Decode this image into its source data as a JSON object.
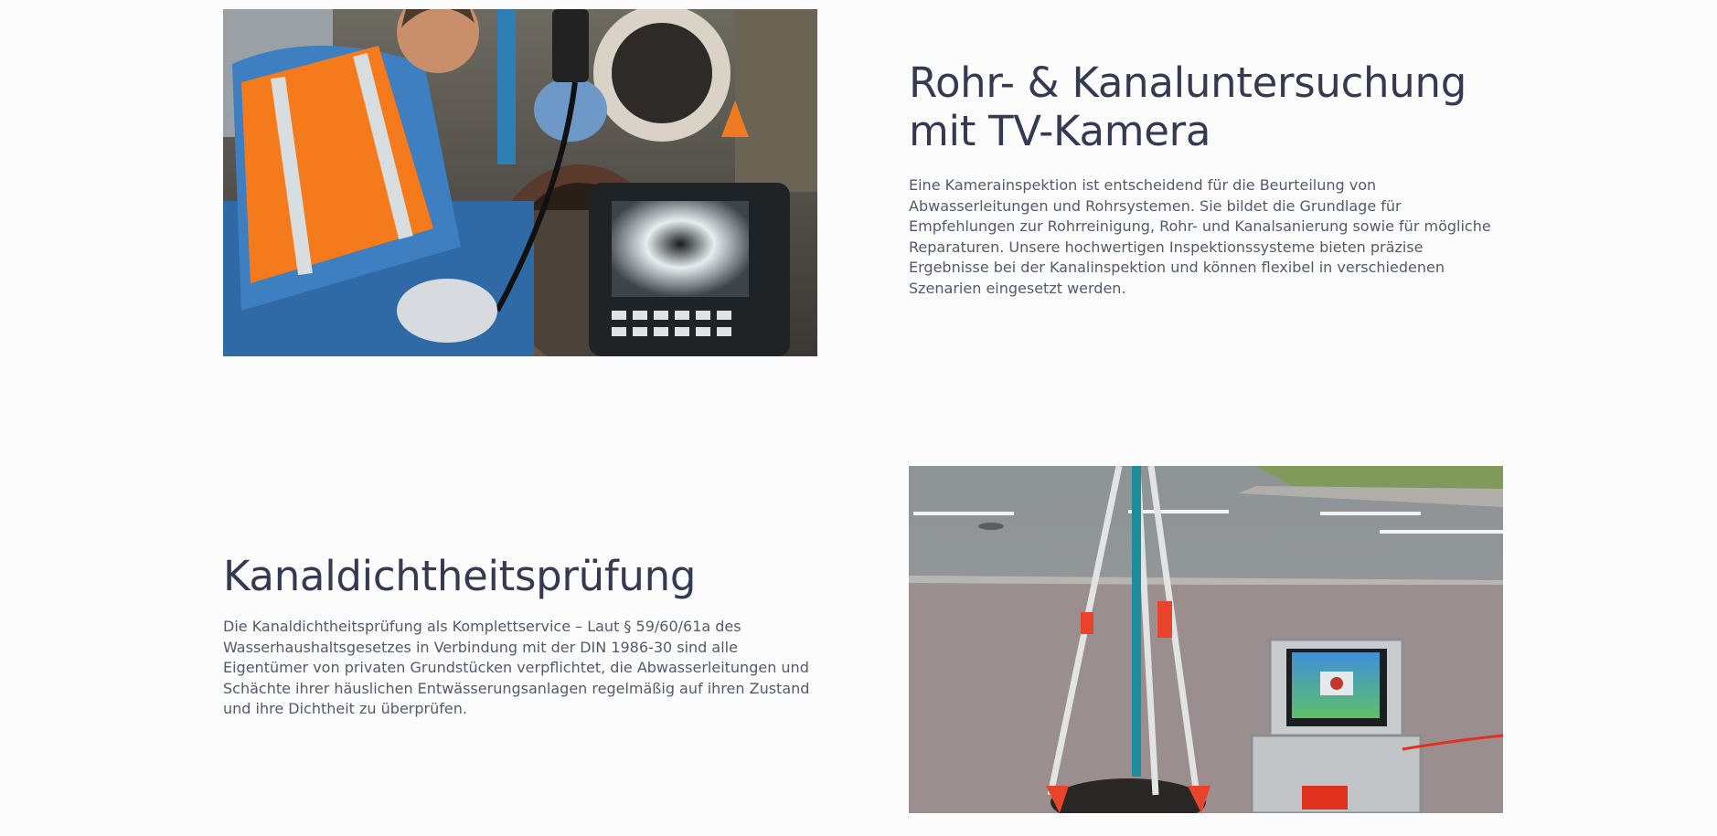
{
  "sections": [
    {
      "title": "Rohr- & Kanaluntersuchung mit TV-Kamera",
      "body": "Eine Kamerainspektion ist entscheidend für die Beurteilung von Abwasserleitungen und Rohrsystemen. Sie bildet die Grundlage für Empfehlungen zur Rohrreinigung, Rohr- und Kanalsanierung sowie für mögliche Reparaturen. Unsere hochwertigen Inspektionssysteme bieten präzise Ergebnisse bei der Kanalinspektion und können flexibel in verschiedenen Szenarien eingesetzt werden.",
      "image_icon": "pipe-camera-inspection-photo"
    },
    {
      "title": "Kanaldichtheitsprüfung",
      "body": "Die Kanaldichtheitsprüfung als Komplettservice – Laut § 59/60/61a des Wasserhaushaltsgesetzes in Verbindung mit der DIN 1986-30 sind alle Eigentümer von privaten Grundstücken verpflichtet, die Abwasserleitungen und Schächte ihrer häuslichen Entwässerungsanlagen regelmäßig auf ihren Zustand und ihre Dichtheit zu überprüfen.",
      "image_icon": "sewer-leak-test-photo"
    }
  ]
}
